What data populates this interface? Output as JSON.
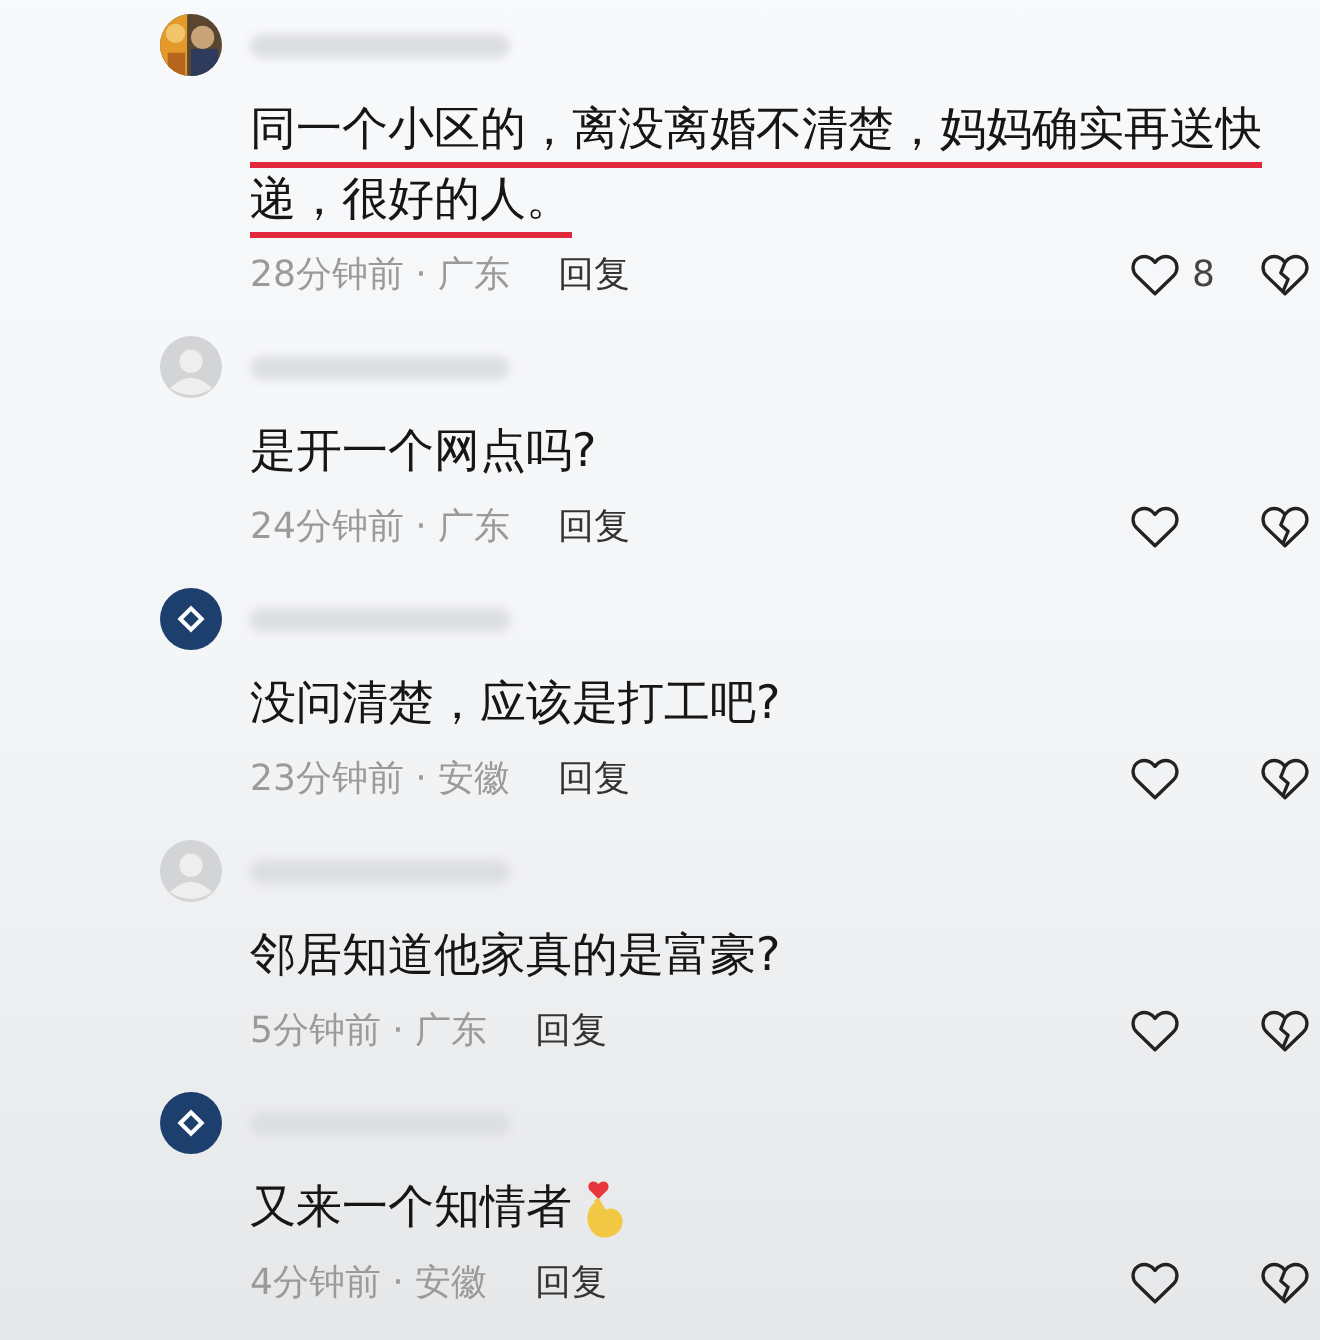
{
  "comments": [
    {
      "text": "同一个小区的，离没离婚不清楚，妈妈确实再送快递，很好的人。",
      "highlighted": true,
      "meta": "28分钟前 · 广东",
      "reply": "回复",
      "likes": "8"
    },
    {
      "avatar": {
        "kind": "default"
      },
      "text": "是开一个网点吗?",
      "highlighted": false,
      "meta": "24分钟前 · 广东",
      "reply": "回复"
    },
    {
      "avatar": {
        "kind": "logo"
      },
      "text": "没问清楚，应该是打工吧?",
      "highlighted": false,
      "meta": "23分钟前 · 安徽",
      "reply": "回复"
    },
    {
      "avatar": {
        "kind": "default"
      },
      "text": "邻居知道他家真的是富豪?",
      "highlighted": false,
      "meta": "5分钟前 · 广东",
      "reply": "回复"
    },
    {
      "avatar": {
        "kind": "logo"
      },
      "text": "又来一个知情者",
      "highlighted": false,
      "sticker": true,
      "meta": "4分钟前 · 安徽",
      "reply": "回复"
    }
  ]
}
